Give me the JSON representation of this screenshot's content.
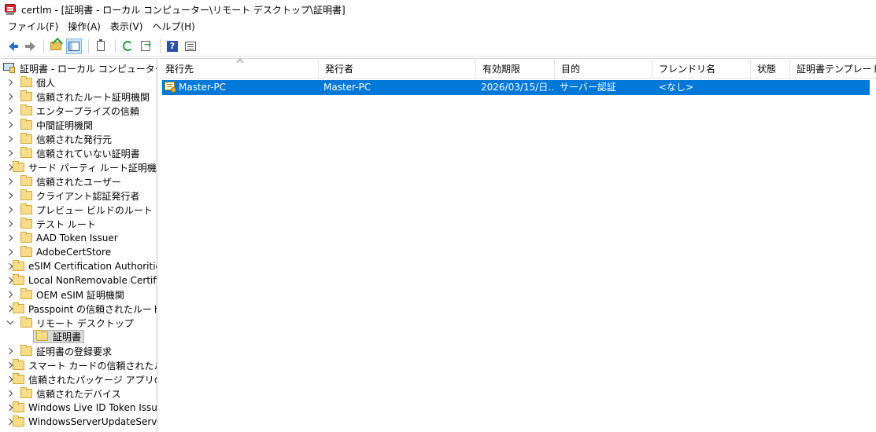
{
  "window": {
    "title": "certlm - [証明書 - ローカル コンピューター\\リモート デスクトップ\\証明書]"
  },
  "menu": {
    "items": [
      "ファイル(F)",
      "操作(A)",
      "表示(V)",
      "ヘルプ(H)"
    ]
  },
  "toolbar": {
    "buttons": [
      "back-icon",
      "forward-icon",
      "up-folder-icon",
      "show-hide-tree-icon",
      "copy-icon",
      "refresh-icon",
      "export-list-icon",
      "help-icon",
      "properties-icon"
    ]
  },
  "tree": {
    "root": "証明書 - ローカル コンピューター",
    "items": [
      "個人",
      "信頼されたルート証明機関",
      "エンタープライズの信頼",
      "中間証明機関",
      "信頼された発行元",
      "信頼されていない証明書",
      "サード パーティ ルート証明機関",
      "信頼されたユーザー",
      "クライアント認証発行者",
      "プレビュー ビルドのルート",
      "テスト ルート",
      "AAD Token Issuer",
      "AdobeCertStore",
      "eSIM Certification Authorities",
      "Local NonRemovable Certificates",
      "OEM eSIM 証明機関",
      "Passpoint の信頼されたルート",
      "リモート デスクトップ",
      "証明書の登録要求",
      "スマート カードの信頼されたルート",
      "信頼されたパッケージ アプリのインストール元",
      "信頼されたデバイス",
      "Windows Live ID Token Issuer",
      "WindowsServerUpdateServices"
    ],
    "expanded_child": "証明書"
  },
  "list": {
    "columns": [
      "発行先",
      "発行者",
      "有効期限",
      "目的",
      "フレンドリ名",
      "状態",
      "証明書テンプレート"
    ],
    "rows": [
      {
        "issued_to": "Master-PC",
        "issued_by": "Master-PC",
        "expiration": "2026/03/15/日...",
        "purpose": "サーバー認証",
        "friendly_name": "<なし>",
        "status": "",
        "template": ""
      }
    ],
    "selection_color": "#0078d7"
  }
}
